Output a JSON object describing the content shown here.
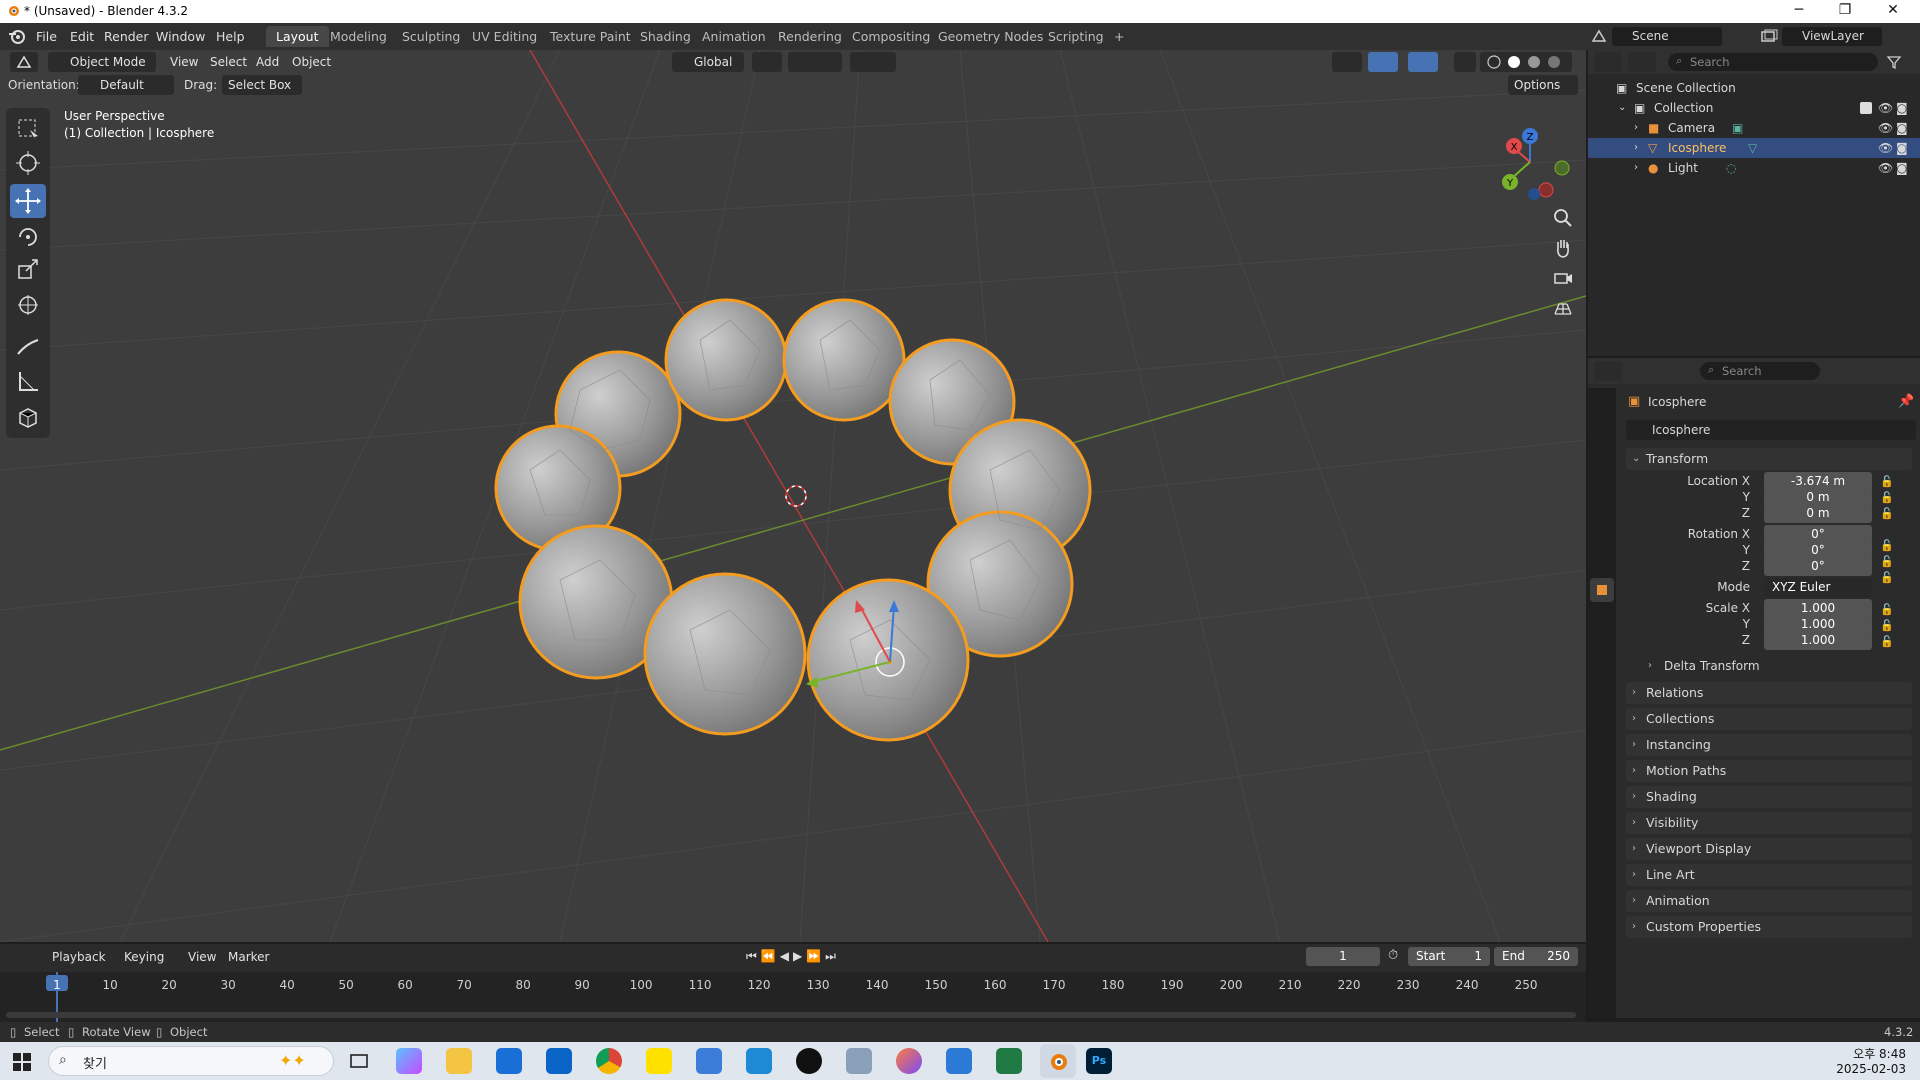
{
  "window": {
    "title": "* (Unsaved) - Blender 4.3.2",
    "controls": [
      "─",
      "❐",
      "✕"
    ]
  },
  "menu": [
    "File",
    "Edit",
    "Render",
    "Window",
    "Help"
  ],
  "workspaces": [
    "Layout",
    "Modeling",
    "Sculpting",
    "UV Editing",
    "Texture Paint",
    "Shading",
    "Animation",
    "Rendering",
    "Compositing",
    "Geometry Nodes",
    "Scripting",
    "+"
  ],
  "active_workspace": "Layout",
  "scene": {
    "name": "Scene",
    "view_layer": "ViewLayer"
  },
  "viewport": {
    "mode": "Object Mode",
    "header_menus": [
      "View",
      "Select",
      "Add",
      "Object"
    ],
    "transform_orientation": "Global",
    "orientation_label": "Orientation:",
    "orientation_value": "Default",
    "drag_label": "Drag:",
    "drag_value": "Select Box",
    "options_label": "Options",
    "overlay_line1": "User Perspective",
    "overlay_line2": "(1) Collection | Icosphere",
    "gizmo_axes": [
      "X",
      "Y",
      "Z"
    ],
    "background_color": "#3d3d3d",
    "selection_outline_color": "#f39c1f"
  },
  "outliner": {
    "search_placeholder": "Search",
    "root": "Scene Collection",
    "collection": "Collection",
    "items": [
      {
        "name": "Camera",
        "selected": false
      },
      {
        "name": "Icosphere",
        "selected": true
      },
      {
        "name": "Light",
        "selected": false
      }
    ]
  },
  "properties": {
    "search_placeholder": "Search",
    "object_name": "Icosphere",
    "data_name": "Icosphere",
    "transform_title": "Transform",
    "location_label": "Location X",
    "location": {
      "x": "-3.674 m",
      "y": "0 m",
      "z": "0 m"
    },
    "rotation_label": "Rotation X",
    "rotation": {
      "x": "0°",
      "y": "0°",
      "z": "0°"
    },
    "mode_label": "Mode",
    "mode_value": "XYZ Euler",
    "scale_label": "Scale X",
    "scale": {
      "x": "1.000",
      "y": "1.000",
      "z": "1.000"
    },
    "axis_labels": [
      "Y",
      "Z"
    ],
    "delta_transform": "Delta Transform",
    "panels": [
      "Relations",
      "Collections",
      "Instancing",
      "Motion Paths",
      "Shading",
      "Visibility",
      "Viewport Display",
      "Line Art",
      "Animation",
      "Custom Properties"
    ]
  },
  "timeline": {
    "menus": [
      "Playback",
      "Keying",
      "View",
      "Marker"
    ],
    "current_frame": "1",
    "start_label": "Start",
    "start": "1",
    "end_label": "End",
    "end": "250",
    "ruler": [
      "1",
      "10",
      "20",
      "30",
      "40",
      "50",
      "60",
      "70",
      "80",
      "90",
      "100",
      "110",
      "120",
      "130",
      "140",
      "150",
      "160",
      "170",
      "180",
      "190",
      "200",
      "210",
      "220",
      "230",
      "240",
      "250"
    ]
  },
  "statusbar": {
    "hints": [
      "Select",
      "Rotate View",
      "Object"
    ],
    "version": "4.3.2"
  },
  "taskbar": {
    "search_label": "찾기",
    "time": "오후 8:48",
    "date": "2025-02-03"
  }
}
